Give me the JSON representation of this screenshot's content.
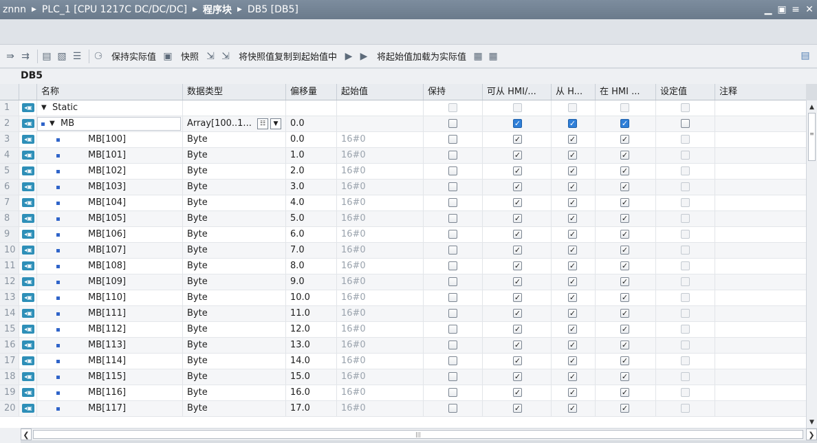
{
  "title_bar": {
    "crumbs": [
      "znnn",
      "PLC_1 [CPU 1217C DC/DC/DC]",
      "程序块",
      "DB5 [DB5]"
    ]
  },
  "toolbar": {
    "keep_actual_label": "保持实际值",
    "snapshot_label": "快照",
    "copy_snapshot_label": "将快照值复制到起始值中",
    "load_start_label": "将起始值加载为实际值"
  },
  "block_name": "DB5",
  "columns": {
    "name": "名称",
    "datatype": "数据类型",
    "offset": "偏移量",
    "start": "起始值",
    "retain": "保持",
    "hmi_access": "可从 HMI/...",
    "hmi_write": "从 H...",
    "hmi_visible": "在 HMI ...",
    "setpoint": "设定值",
    "comment": "注释"
  },
  "rows": [
    {
      "num": "1",
      "name": "Static",
      "type": "",
      "offset": "",
      "start": ""
    },
    {
      "num": "2",
      "name": "MB",
      "type": "Array[100..1...",
      "offset": "0.0",
      "start": ""
    },
    {
      "num": "3",
      "name": "MB[100]",
      "type": "Byte",
      "offset": "0.0",
      "start": "16#0"
    },
    {
      "num": "4",
      "name": "MB[101]",
      "type": "Byte",
      "offset": "1.0",
      "start": "16#0"
    },
    {
      "num": "5",
      "name": "MB[102]",
      "type": "Byte",
      "offset": "2.0",
      "start": "16#0"
    },
    {
      "num": "6",
      "name": "MB[103]",
      "type": "Byte",
      "offset": "3.0",
      "start": "16#0"
    },
    {
      "num": "7",
      "name": "MB[104]",
      "type": "Byte",
      "offset": "4.0",
      "start": "16#0"
    },
    {
      "num": "8",
      "name": "MB[105]",
      "type": "Byte",
      "offset": "5.0",
      "start": "16#0"
    },
    {
      "num": "9",
      "name": "MB[106]",
      "type": "Byte",
      "offset": "6.0",
      "start": "16#0"
    },
    {
      "num": "10",
      "name": "MB[107]",
      "type": "Byte",
      "offset": "7.0",
      "start": "16#0"
    },
    {
      "num": "11",
      "name": "MB[108]",
      "type": "Byte",
      "offset": "8.0",
      "start": "16#0"
    },
    {
      "num": "12",
      "name": "MB[109]",
      "type": "Byte",
      "offset": "9.0",
      "start": "16#0"
    },
    {
      "num": "13",
      "name": "MB[110]",
      "type": "Byte",
      "offset": "10.0",
      "start": "16#0"
    },
    {
      "num": "14",
      "name": "MB[111]",
      "type": "Byte",
      "offset": "11.0",
      "start": "16#0"
    },
    {
      "num": "15",
      "name": "MB[112]",
      "type": "Byte",
      "offset": "12.0",
      "start": "16#0"
    },
    {
      "num": "16",
      "name": "MB[113]",
      "type": "Byte",
      "offset": "13.0",
      "start": "16#0"
    },
    {
      "num": "17",
      "name": "MB[114]",
      "type": "Byte",
      "offset": "14.0",
      "start": "16#0"
    },
    {
      "num": "18",
      "name": "MB[115]",
      "type": "Byte",
      "offset": "15.0",
      "start": "16#0"
    },
    {
      "num": "19",
      "name": "MB[116]",
      "type": "Byte",
      "offset": "16.0",
      "start": "16#0"
    },
    {
      "num": "20",
      "name": "MB[117]",
      "type": "Byte",
      "offset": "17.0",
      "start": "16#0"
    }
  ]
}
